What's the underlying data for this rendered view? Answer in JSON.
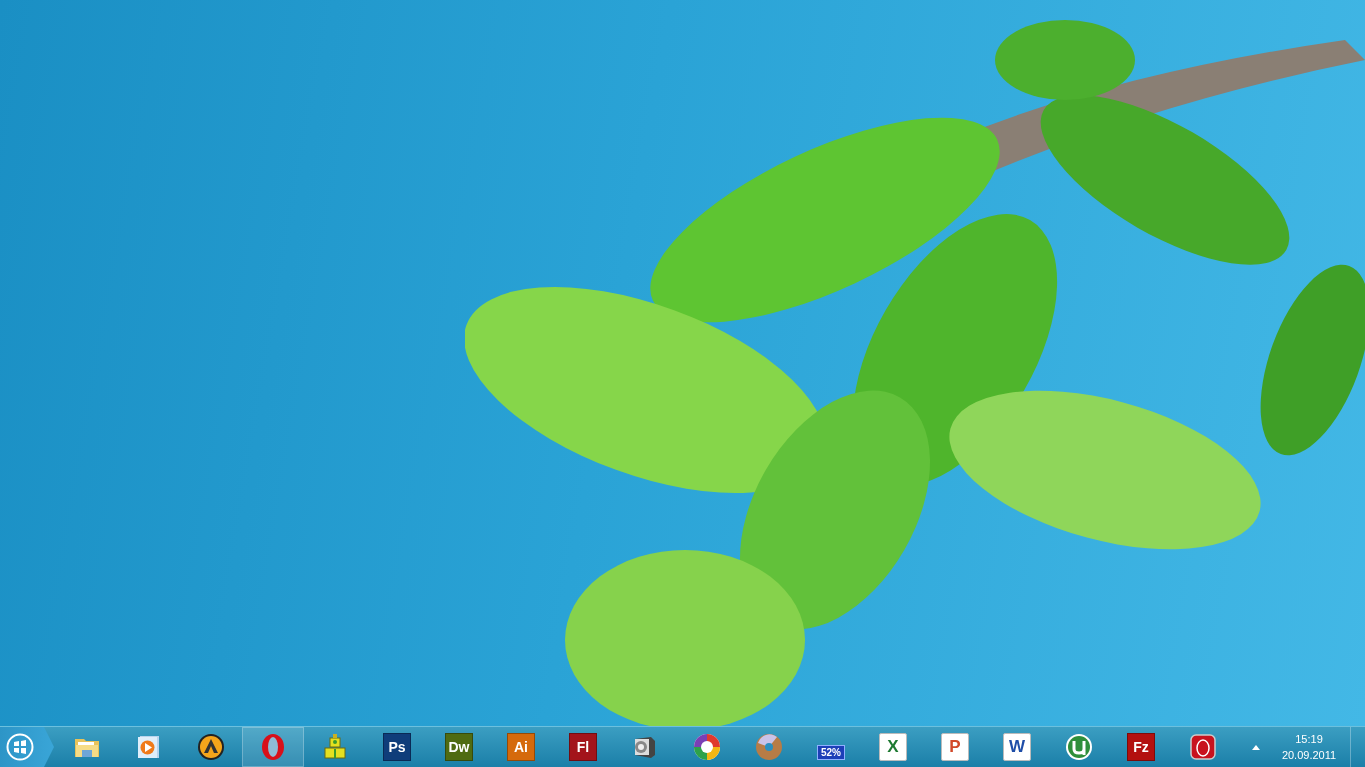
{
  "taskbar": {
    "apps": [
      {
        "kind": "folder",
        "running": false
      },
      {
        "kind": "media",
        "running": false
      },
      {
        "kind": "aimp",
        "running": false
      },
      {
        "kind": "opera",
        "running": true
      },
      {
        "kind": "qip",
        "running": false
      },
      {
        "kind": "tile",
        "label": "Ps",
        "color": "#0f3d7a",
        "running": false
      },
      {
        "kind": "tile",
        "label": "Dw",
        "color": "#4f6b12",
        "running": false
      },
      {
        "kind": "tile",
        "label": "Ai",
        "color": "#d56a0c",
        "running": false
      },
      {
        "kind": "tile",
        "label": "Fl",
        "color": "#a3141b",
        "running": false
      },
      {
        "kind": "webcam",
        "running": false
      },
      {
        "kind": "picasa",
        "running": false
      },
      {
        "kind": "disc",
        "running": false
      },
      {
        "kind": "badge",
        "label": "52%",
        "running": false
      },
      {
        "kind": "doc",
        "label": "X",
        "color": "#1e7a32",
        "running": false
      },
      {
        "kind": "doc",
        "label": "P",
        "color": "#d2492a",
        "running": false
      },
      {
        "kind": "doc",
        "label": "W",
        "color": "#1f4ea8",
        "running": false
      },
      {
        "kind": "utorrent",
        "running": false
      },
      {
        "kind": "tile",
        "label": "Fz",
        "color": "#b3100f",
        "running": false
      },
      {
        "kind": "redapp",
        "running": false
      }
    ],
    "clock": {
      "time": "15:19",
      "date": "20.09.2011"
    }
  }
}
